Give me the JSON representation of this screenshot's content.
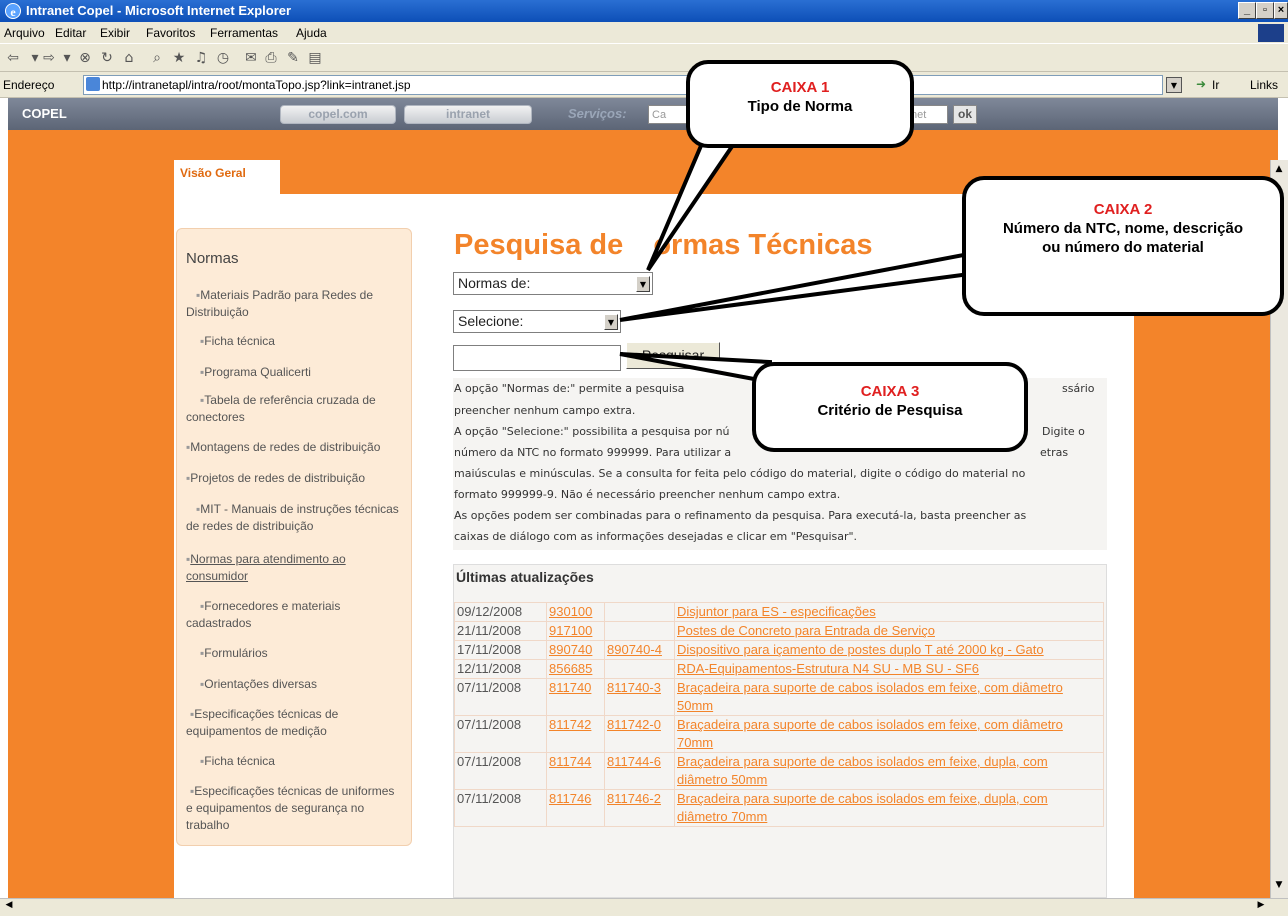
{
  "window": {
    "title": "Intranet Copel - Microsoft Internet Explorer"
  },
  "menu": [
    "Arquivo",
    "Editar",
    "Exibir",
    "Favoritos",
    "Ferramentas",
    "Ajuda"
  ],
  "address": {
    "label": "Endereço",
    "url": "http://intranetapl/intra/root/montaTopo.jsp?link=intranet.jsp",
    "go": "Ir",
    "links": "Links"
  },
  "topnav": {
    "logo": "COPEL",
    "copelcom": "copel.com",
    "intranet": "intranet",
    "servicos": "Serviços:",
    "input_visible_start": "Ca",
    "input_visible_end": "net",
    "ok": "ok"
  },
  "tab": "Visão Geral",
  "sidebar": {
    "title": "Normas",
    "items": [
      "Materiais Padrão para Redes de Distribuição",
      "Ficha técnica",
      "Programa Qualicerti",
      "Tabela de referência cruzada de conectores",
      "Montagens de redes de distribuição",
      "Projetos de redes de distribuição",
      "MIT - Manuais de instruções técnicas de redes de distribuição",
      "Normas para atendimento ao consumidor",
      "Fornecedores e materiais cadastrados",
      "Formulários",
      "Orientações diversas",
      "Especificações técnicas de equipamentos de medição",
      "Ficha técnica",
      "Especificações técnicas de uniformes e equipamentos de segurança no trabalho"
    ]
  },
  "main": {
    "title_start": "Pesquisa de ",
    "title_end": "ormas Técnicas",
    "select1": "Normas de:",
    "select2": "Selecione:",
    "search_button": "Pesquisar",
    "help_lines": [
      "A opção \"Normas de:\" permite a pesquisa",
      "ssário",
      "preencher nenhum campo extra.",
      "A opção \"Selecione:\" possibilita a pesquisa por nú",
      "Digite o",
      "número da NTC no formato 999999. Para utilizar a",
      "etras",
      "maiúsculas e minúsculas. Se a consulta for feita pelo código do material, digite o código do material no",
      "formato 999999-9. Não é necessário preencher nenhum campo extra.",
      "As opções podem ser combinadas para o refinamento da pesquisa. Para executá-la, basta preencher as",
      "caixas de diálogo com as informações desejadas e clicar em \"Pesquisar\"."
    ]
  },
  "updates": {
    "title": "Últimas atualizações",
    "rows": [
      {
        "date": "09/12/2008",
        "code": "930100",
        "code2": "",
        "desc": "Disjuntor para ES - especificações"
      },
      {
        "date": "21/11/2008",
        "code": "917100",
        "code2": "",
        "desc": "Postes de Concreto para Entrada de Serviço"
      },
      {
        "date": "17/11/2008",
        "code": "890740",
        "code2": "890740-4",
        "desc": "Dispositivo para içamento de postes duplo T até 2000 kg - Gato"
      },
      {
        "date": "12/11/2008",
        "code": "856685",
        "code2": "",
        "desc": "RDA-Equipamentos-Estrutura N4 SU - MB SU - SF6"
      },
      {
        "date": "07/11/2008",
        "code": "811740",
        "code2": "811740-3",
        "desc": "Braçadeira para suporte de cabos isolados em feixe, com diâmetro 50mm"
      },
      {
        "date": "07/11/2008",
        "code": "811742",
        "code2": "811742-0",
        "desc": "Braçadeira para suporte de cabos isolados em feixe, com diâmetro 70mm"
      },
      {
        "date": "07/11/2008",
        "code": "811744",
        "code2": "811744-6",
        "desc": "Braçadeira para suporte de cabos isolados em feixe, dupla, com diâmetro 50mm"
      },
      {
        "date": "07/11/2008",
        "code": "811746",
        "code2": "811746-2",
        "desc": "Braçadeira para suporte de cabos isolados em feixe, dupla, com diâmetro 70mm"
      }
    ]
  },
  "callouts": {
    "c1": {
      "title": "CAIXA 1",
      "text": "Tipo de Norma"
    },
    "c2": {
      "title": "CAIXA 2",
      "text": "Número da NTC, nome, descrição ou número do material"
    },
    "c3": {
      "title": "CAIXA 3",
      "text": "Critério de Pesquisa"
    }
  }
}
